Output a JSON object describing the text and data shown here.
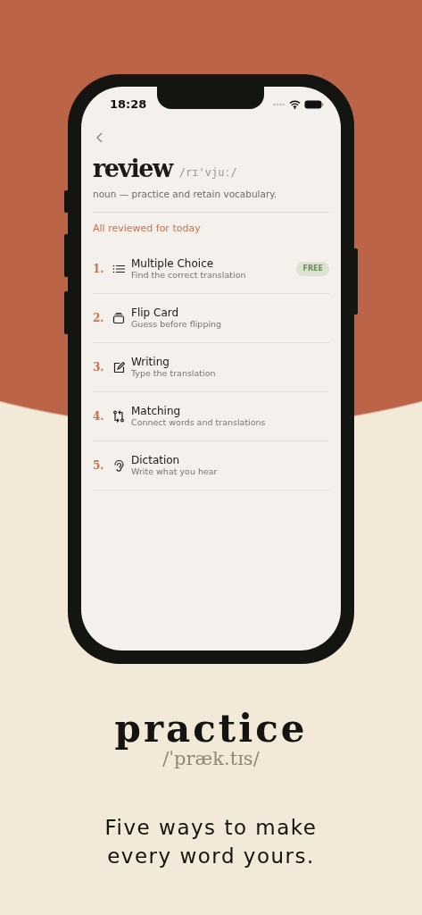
{
  "status_bar": {
    "time": "18:28"
  },
  "word": {
    "title": "review",
    "pronunciation": "/rɪ'vjuː/",
    "definition": "noun — practice and retain vocabulary."
  },
  "status_message": "All reviewed for today",
  "exercises": [
    {
      "number": "1.",
      "kind": "list",
      "title": "Multiple Choice",
      "subtitle": "Find the correct translation",
      "badge": "FREE"
    },
    {
      "number": "2.",
      "kind": "card",
      "title": "Flip Card",
      "subtitle": "Guess before flipping"
    },
    {
      "number": "3.",
      "kind": "edit",
      "title": "Writing",
      "subtitle": "Type the translation"
    },
    {
      "number": "4.",
      "kind": "swap",
      "title": "Matching",
      "subtitle": "Connect words and translations"
    },
    {
      "number": "5.",
      "kind": "ear",
      "title": "Dictation",
      "subtitle": "Write what you hear"
    }
  ],
  "headline": {
    "word": "practice",
    "pronunciation": "/ˈpræk.tɪs/",
    "tagline": "Five ways to make every word yours."
  }
}
